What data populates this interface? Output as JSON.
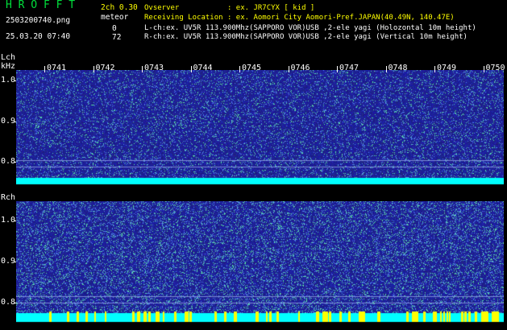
{
  "header": {
    "app_title": "H R O F F T",
    "filename": "2503200740.png",
    "datetime": "25.03.20 07:40",
    "channel_label": "2ch 0.30",
    "meteor_label": "meteor",
    "count_lch": "0",
    "count_rch": "72",
    "observer_line": "Ovserver           : ex. JR7CYX [ kid ]",
    "location_line": "Receiving Location : ex. Aomori City Aomori-Pref.JAPAN(40.49N, 140.47E)",
    "lch_line": "L-ch:ex. UV5R 113.900Mhz(SAPPORO VOR)USB ,2-ele yagi (Holozontal 10m height)",
    "rch_line": "R-ch:ex. UV5R 113.900Mhz(SAPPORO VOR)USB ,2-ele yagi (Vertical 10m height)"
  },
  "lch": {
    "label": "Lch",
    "unit": "kHz",
    "ticks": [
      "1.0",
      "0.9",
      "0.8"
    ]
  },
  "rch": {
    "label": "Rch",
    "ticks": [
      "1.0",
      "0.9",
      "0.8"
    ]
  },
  "time_axis": [
    "0741",
    "0742",
    "0743",
    "0744",
    "0745",
    "0746",
    "0747",
    "0748",
    "0749",
    "0750"
  ],
  "colors": {
    "background": "#000000",
    "header_green": "#00e03c",
    "header_yellow": "#ffff00",
    "noise_base": "#1a1aa0",
    "band_cyan": "#00ffff",
    "meteor_yellow": "#ffff00"
  }
}
